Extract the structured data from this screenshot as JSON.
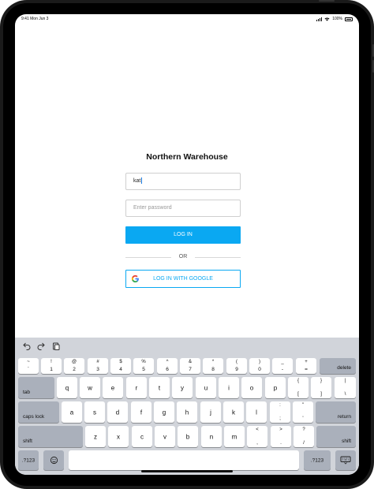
{
  "status": {
    "time_date": "9:41 Mon Jun 3",
    "battery": "100%"
  },
  "app": {
    "title": "Northern Warehouse",
    "username_value": "kat",
    "password_placeholder": "Enter password",
    "login_label": "LOG IN",
    "or_label": "OR",
    "google_label": "LOG IN WITH GOOGLE"
  },
  "colors": {
    "accent": "#0aa8f2",
    "keyboard_bg": "#d1d4da",
    "dark_key": "#aab0bb"
  },
  "keyboard": {
    "toolbar_icons": [
      "undo-icon",
      "redo-icon",
      "paste-icon"
    ],
    "row1": [
      {
        "top": "~",
        "bot": "`"
      },
      {
        "top": "!",
        "bot": "1"
      },
      {
        "top": "@",
        "bot": "2"
      },
      {
        "top": "#",
        "bot": "3"
      },
      {
        "top": "$",
        "bot": "4"
      },
      {
        "top": "%",
        "bot": "5"
      },
      {
        "top": "^",
        "bot": "6"
      },
      {
        "top": "&",
        "bot": "7"
      },
      {
        "top": "*",
        "bot": "8"
      },
      {
        "top": "(",
        "bot": "9"
      },
      {
        "top": ")",
        "bot": "0"
      },
      {
        "top": "_",
        "bot": "-"
      },
      {
        "top": "+",
        "bot": "="
      }
    ],
    "delete": "delete",
    "tab": "tab",
    "row2": [
      "q",
      "w",
      "e",
      "r",
      "t",
      "y",
      "u",
      "i",
      "o",
      "p"
    ],
    "row2_sym": [
      {
        "top": "{",
        "bot": "["
      },
      {
        "top": "}",
        "bot": "]"
      },
      {
        "top": "|",
        "bot": "\\"
      }
    ],
    "caps": "caps lock",
    "row3": [
      "a",
      "s",
      "d",
      "f",
      "g",
      "h",
      "j",
      "k",
      "l"
    ],
    "row3_sym": [
      {
        "top": ":",
        "bot": ";"
      },
      {
        "top": "\"",
        "bot": "'"
      }
    ],
    "return": "return",
    "shift": "shift",
    "row4": [
      "z",
      "x",
      "c",
      "v",
      "b",
      "n",
      "m"
    ],
    "row4_sym": [
      {
        "top": "<",
        "bot": ","
      },
      {
        "top": ">",
        "bot": "."
      },
      {
        "top": "?",
        "bot": "/"
      }
    ],
    "numbers": ".?123"
  }
}
